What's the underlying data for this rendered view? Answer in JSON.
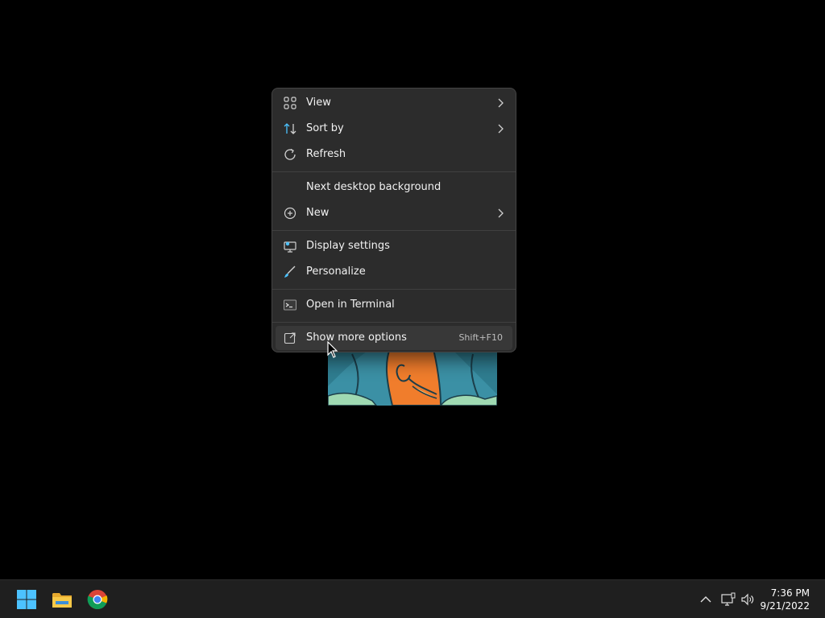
{
  "context_menu": {
    "items": [
      {
        "label": "View",
        "icon": "grid-view-icon",
        "submenu": true
      },
      {
        "label": "Sort by",
        "icon": "sort-arrows-icon",
        "submenu": true
      },
      {
        "label": "Refresh",
        "icon": "refresh-icon",
        "submenu": false
      },
      {
        "label": "Next desktop background",
        "icon": "",
        "submenu": false
      },
      {
        "label": "New",
        "icon": "add-circle-icon",
        "submenu": true
      },
      {
        "label": "Display settings",
        "icon": "display-icon",
        "submenu": false
      },
      {
        "label": "Personalize",
        "icon": "brush-icon",
        "submenu": false
      },
      {
        "label": "Open in Terminal",
        "icon": "terminal-icon",
        "submenu": false
      },
      {
        "label": "Show more options",
        "icon": "open-external-icon",
        "shortcut": "Shift+F10",
        "hovered": true
      }
    ]
  },
  "taskbar": {
    "apps": [
      {
        "name": "Start",
        "icon": "windows-logo-icon"
      },
      {
        "name": "File Explorer",
        "icon": "folder-icon"
      },
      {
        "name": "Google Chrome",
        "icon": "chrome-icon"
      }
    ],
    "tray": {
      "icons": [
        "chevron-up-icon",
        "network-icon",
        "volume-icon"
      ],
      "time": "7:36 PM",
      "date": "9/21/2022"
    }
  },
  "colors": {
    "menu_bg": "#2c2c2c",
    "menu_hover": "#383838",
    "taskbar_bg": "#1f1f1f",
    "accent_blue": "#0078d4"
  }
}
